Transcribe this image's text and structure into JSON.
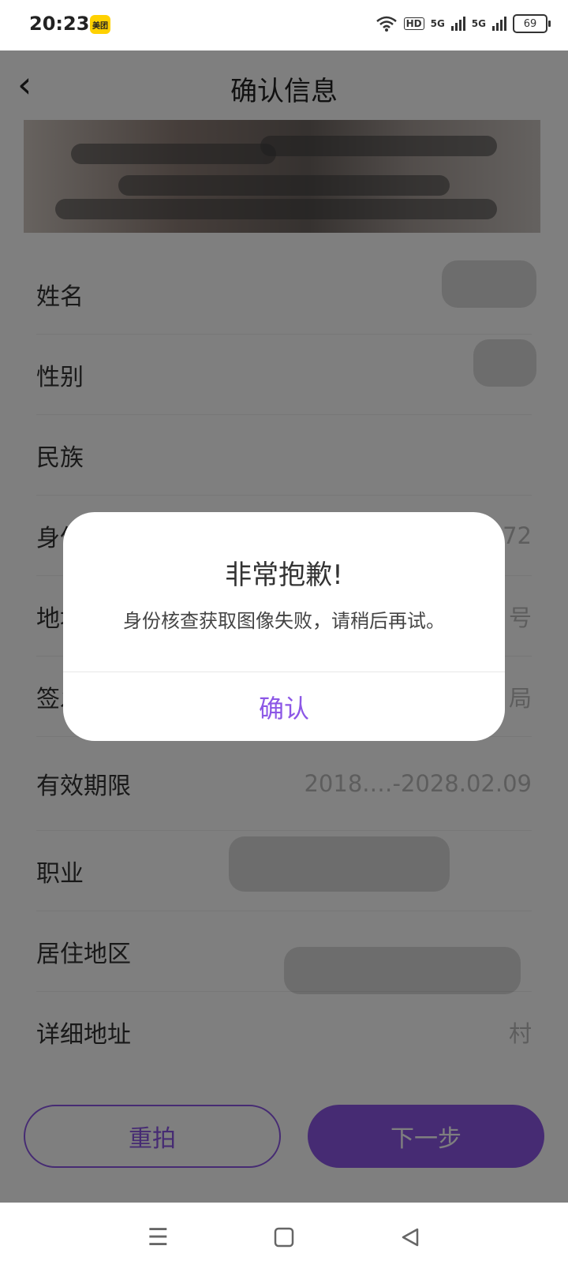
{
  "status_bar": {
    "time": "20:23",
    "app_badge": "美团",
    "network_hd": "HD",
    "signal1": "5G",
    "signal2": "5G",
    "battery": "69"
  },
  "header": {
    "title": "确认信息",
    "back_icon": "chevron-left-icon"
  },
  "form": {
    "rows": [
      {
        "label": "姓名",
        "value": ""
      },
      {
        "label": "性别",
        "value": ""
      },
      {
        "label": "民族",
        "value": ""
      },
      {
        "label": "身份证号",
        "value": "72"
      },
      {
        "label": "地址",
        "value": "号"
      },
      {
        "label": "签发机关",
        "value": "局"
      },
      {
        "label": "有效期限",
        "value": "2018.…-2028.02.09"
      },
      {
        "label": "职业",
        "value": ""
      },
      {
        "label": "居住地区",
        "value": ""
      },
      {
        "label": "详细地址",
        "value": "村"
      }
    ]
  },
  "buttons": {
    "retake": "重拍",
    "next": "下一步"
  },
  "dialog": {
    "title": "非常抱歉!",
    "message": "身份核查获取图像失败，请稍后再试。",
    "confirm": "确认"
  },
  "colors": {
    "accent": "#8c57e6",
    "overlay": "rgba(0,0,0,0.5)"
  },
  "nav": {
    "menu_icon": "menu-icon",
    "home_icon": "square-home-icon",
    "back_icon": "triangle-back-icon"
  }
}
